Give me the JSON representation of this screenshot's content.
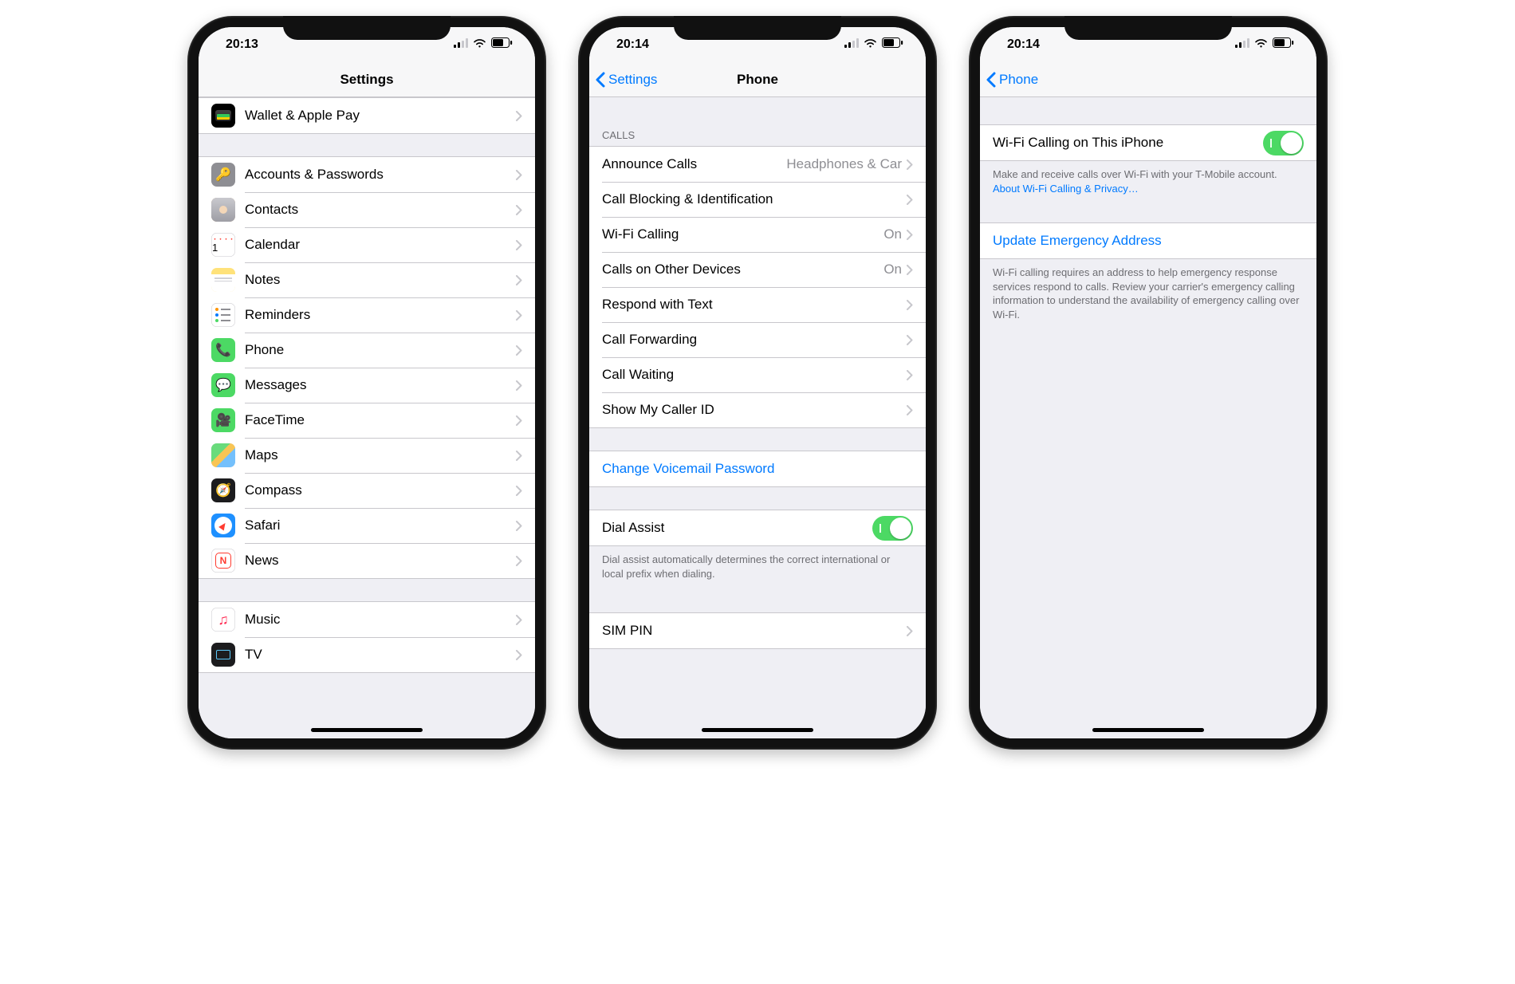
{
  "phones": [
    {
      "time": "20:13",
      "nav": {
        "title": "Settings",
        "back": null
      },
      "groups": [
        {
          "header": null,
          "footer": null,
          "tight": true,
          "rows": [
            {
              "icon": "wallet",
              "label": "Wallet & Apple Pay",
              "chev": true
            }
          ]
        },
        {
          "header": null,
          "footer": null,
          "rows": [
            {
              "icon": "key",
              "label": "Accounts & Passwords",
              "chev": true
            },
            {
              "icon": "contacts",
              "label": "Contacts",
              "chev": true
            },
            {
              "icon": "calendar",
              "label": "Calendar",
              "chev": true
            },
            {
              "icon": "notes",
              "label": "Notes",
              "chev": true
            },
            {
              "icon": "reminders",
              "label": "Reminders",
              "chev": true
            },
            {
              "icon": "phone",
              "label": "Phone",
              "chev": true
            },
            {
              "icon": "messages",
              "label": "Messages",
              "chev": true
            },
            {
              "icon": "facetime",
              "label": "FaceTime",
              "chev": true
            },
            {
              "icon": "maps",
              "label": "Maps",
              "chev": true
            },
            {
              "icon": "compass",
              "label": "Compass",
              "chev": true
            },
            {
              "icon": "safari",
              "label": "Safari",
              "chev": true
            },
            {
              "icon": "news",
              "label": "News",
              "chev": true
            }
          ]
        },
        {
          "header": null,
          "footer": null,
          "rows": [
            {
              "icon": "music",
              "label": "Music",
              "chev": true
            },
            {
              "icon": "tv",
              "label": "TV",
              "chev": true
            }
          ]
        }
      ]
    },
    {
      "time": "20:14",
      "nav": {
        "title": "Phone",
        "back": "Settings"
      },
      "groups": [
        {
          "header": "CALLS",
          "footer": null,
          "spacerTop": true,
          "rows": [
            {
              "label": "Announce Calls",
              "detail": "Headphones & Car",
              "chev": true
            },
            {
              "label": "Call Blocking & Identification",
              "chev": true
            },
            {
              "label": "Wi-Fi Calling",
              "detail": "On",
              "chev": true
            },
            {
              "label": "Calls on Other Devices",
              "detail": "On",
              "chev": true
            },
            {
              "label": "Respond with Text",
              "chev": true
            },
            {
              "label": "Call Forwarding",
              "chev": true
            },
            {
              "label": "Call Waiting",
              "chev": true
            },
            {
              "label": "Show My Caller ID",
              "chev": true
            }
          ]
        },
        {
          "header": null,
          "footer": null,
          "rows": [
            {
              "label": "Change Voicemail Password",
              "link": true
            }
          ]
        },
        {
          "header": null,
          "footer": "Dial assist automatically determines the correct international or local prefix when dialing.",
          "rows": [
            {
              "label": "Dial Assist",
              "toggle": true
            }
          ]
        },
        {
          "header": null,
          "footer": null,
          "spacerTop": true,
          "rows": [
            {
              "label": "SIM PIN",
              "chev": true
            }
          ]
        }
      ]
    },
    {
      "time": "20:14",
      "nav": {
        "title": "",
        "back": "Phone"
      },
      "groups": [
        {
          "header": null,
          "spacerTop": true,
          "footer": "Make and receive calls over Wi-Fi with your T-Mobile account. ",
          "footerLink": "About Wi-Fi Calling & Privacy…",
          "rows": [
            {
              "label": "Wi-Fi Calling on This iPhone",
              "toggle": true
            }
          ]
        },
        {
          "header": null,
          "footer": "Wi-Fi calling requires an address to help emergency response services respond to calls. Review your carrier's emergency calling information to understand the availability of emergency calling over Wi-Fi.",
          "rows": [
            {
              "label": "Update Emergency Address",
              "link": true
            }
          ]
        }
      ]
    }
  ],
  "iconColors": {
    "wallet": "#000000",
    "key": "#8e8e93",
    "contacts": "#b98b60",
    "calendar": "#ffffff",
    "notes": "#ffe27a",
    "reminders": "#ffffff",
    "phone": "#4cd964",
    "messages": "#4cd964",
    "facetime": "#4cd964",
    "maps": "#ffffff",
    "compass": "#1c1c1e",
    "safari": "#1e90ff",
    "news": "#ffffff",
    "music": "#ffffff",
    "tv": "#1c1c1e"
  }
}
